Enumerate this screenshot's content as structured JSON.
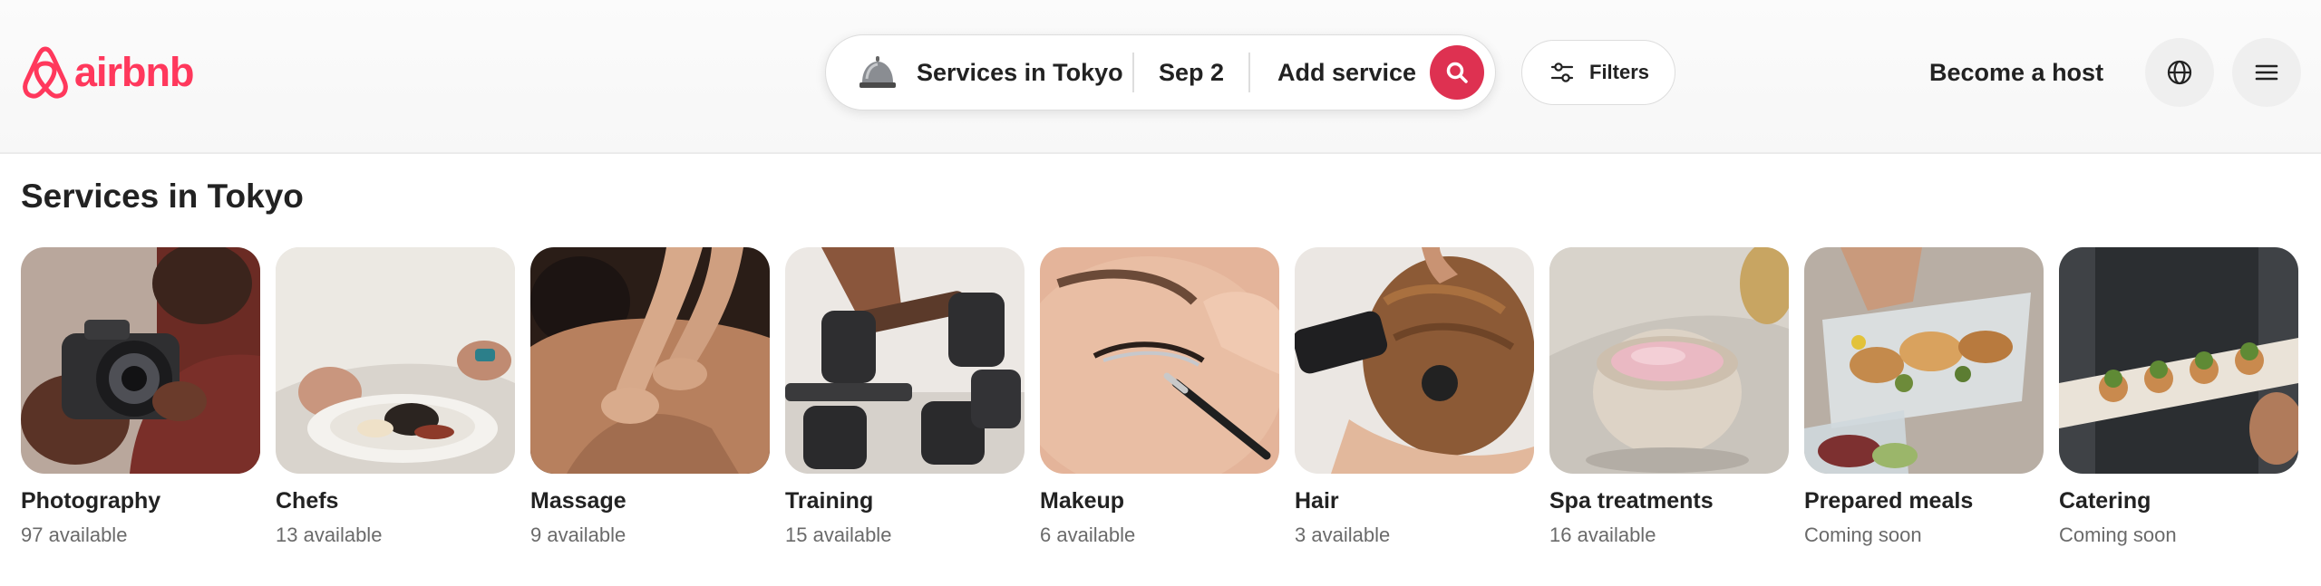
{
  "header": {
    "logo_text": "airbnb",
    "brand_color": "#FF385C",
    "search": {
      "service_label": "Services in Tokyo",
      "service_icon": "service-bell-icon",
      "date_label": "Sep 2",
      "add_label": "Add service",
      "search_icon": "search-icon",
      "accent_color": "#DE3151"
    },
    "filters_label": "Filters",
    "filters_icon": "sliders-icon",
    "become_host_label": "Become a host",
    "globe_icon": "globe-icon",
    "menu_icon": "hamburger-menu-icon"
  },
  "main": {
    "title": "Services in Tokyo",
    "categories": [
      {
        "name": "Photography",
        "status": "97 available"
      },
      {
        "name": "Chefs",
        "status": "13 available"
      },
      {
        "name": "Massage",
        "status": "9 available"
      },
      {
        "name": "Training",
        "status": "15 available"
      },
      {
        "name": "Makeup",
        "status": "6 available"
      },
      {
        "name": "Hair",
        "status": "3 available"
      },
      {
        "name": "Spa treatments",
        "status": "16 available"
      },
      {
        "name": "Prepared meals",
        "status": "Coming soon"
      },
      {
        "name": "Catering",
        "status": "Coming soon"
      }
    ]
  }
}
